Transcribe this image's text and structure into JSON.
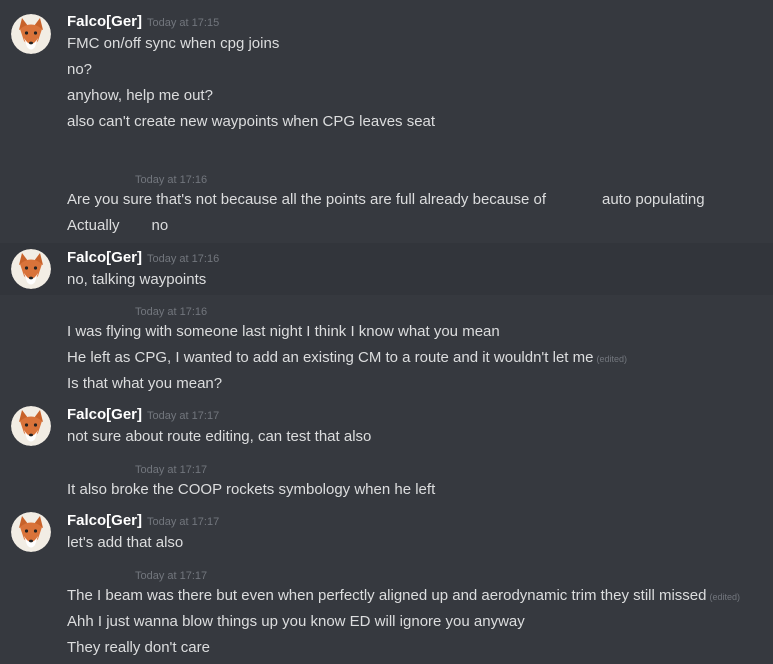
{
  "groups": [
    {
      "author": "Falco[Ger]",
      "timestamp": "Today at 17:15",
      "lines": [
        "FMC on/off sync when cpg joins",
        "no?",
        "anyhow, help me out?",
        "also can't create new waypoints when CPG leaves seat"
      ]
    },
    {
      "timestamp": "Today at 17:16",
      "line1_a": "Are you sure that's not because all the points are full already because of",
      "line1_b": "auto populating",
      "line2_a": "Actually",
      "line2_b": "no"
    },
    {
      "author": "Falco[Ger]",
      "timestamp": "Today at 17:16",
      "lines": [
        "no, talking waypoints"
      ]
    },
    {
      "timestamp": "Today at 17:16",
      "lines": [
        "I was flying with someone last night I think I know what you mean",
        "He left as CPG, I wanted to add an existing CM to a route and it wouldn't let me",
        "Is that what you mean?"
      ],
      "edited_label": "(edited)"
    },
    {
      "author": "Falco[Ger]",
      "timestamp": "Today at 17:17",
      "lines": [
        "not sure about route editing, can test that also"
      ]
    },
    {
      "timestamp": "Today at 17:17",
      "lines": [
        "It also broke the COOP rockets symbology when he left"
      ]
    },
    {
      "author": "Falco[Ger]",
      "timestamp": "Today at 17:17",
      "lines": [
        "let's add that also"
      ]
    },
    {
      "timestamp": "Today at 17:17",
      "lines": [
        "The I beam was there but even when perfectly aligned up and aerodynamic trim they still missed",
        "Ahh I just wanna blow things up you know ED will ignore you anyway",
        "They really don't care"
      ],
      "edited_label": "(edited)"
    }
  ],
  "colors": {
    "background": "#36393f",
    "highlight": "#32353b",
    "text": "#dcddde",
    "muted": "#72767d",
    "author": "#ffffff"
  },
  "icons": {
    "avatar": "fox-avatar-icon"
  }
}
